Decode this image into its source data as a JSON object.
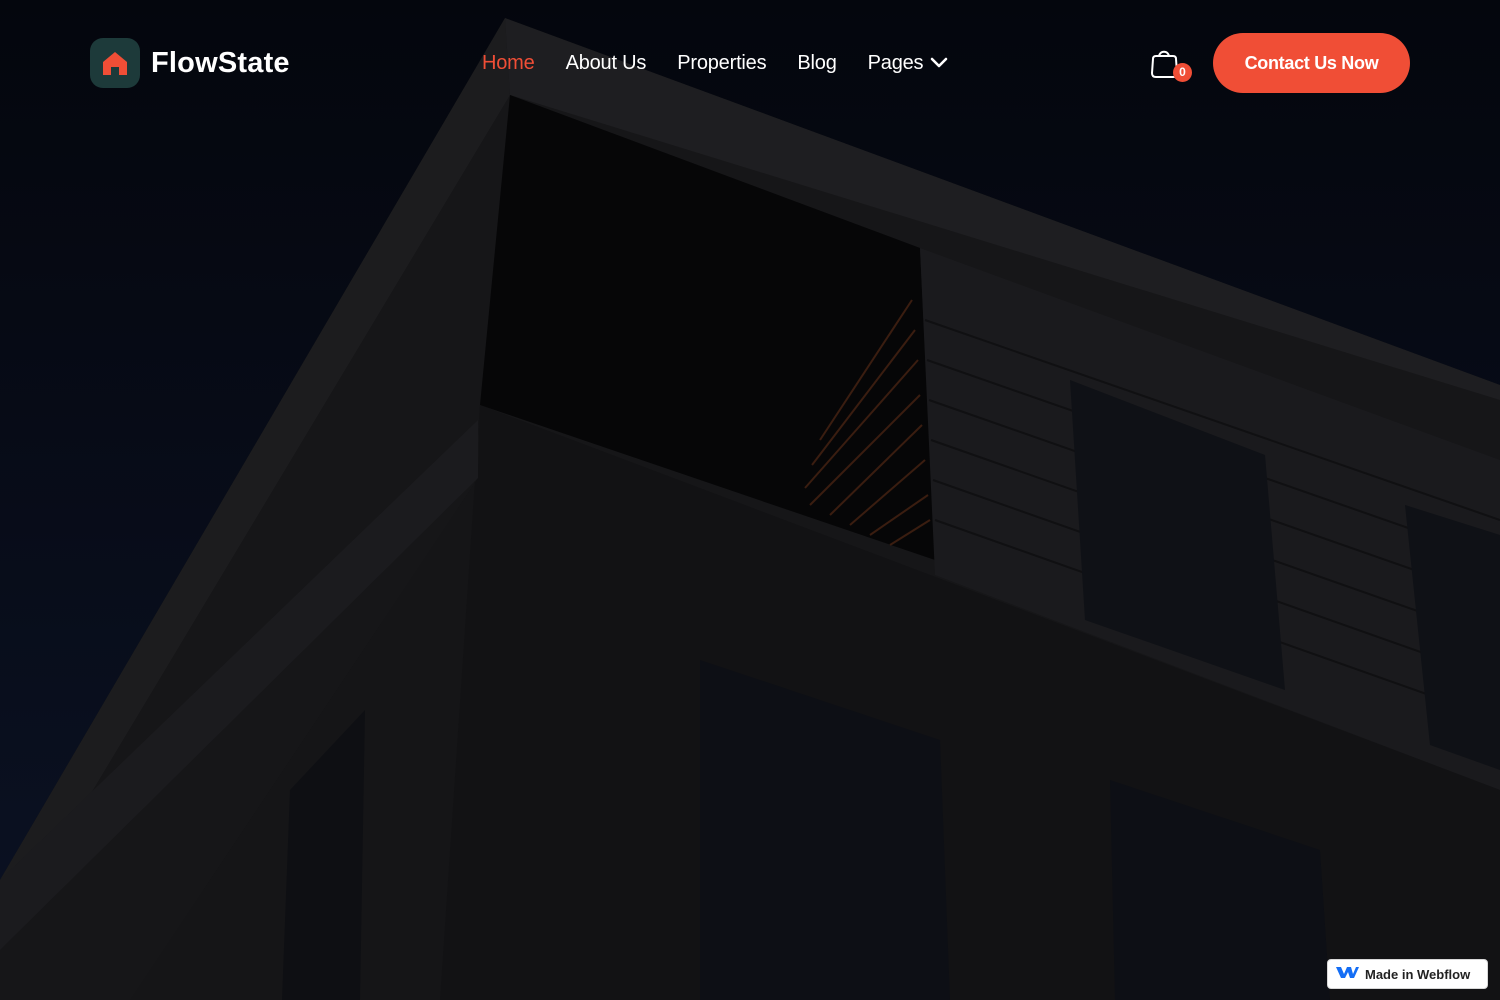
{
  "brand": {
    "name": "FlowState",
    "logo_icon": "house-icon",
    "accent_color": "#f04e36",
    "logo_badge_color": "#1d3a3a"
  },
  "nav": {
    "items": [
      {
        "label": "Home",
        "active": true
      },
      {
        "label": "About Us",
        "active": false
      },
      {
        "label": "Properties",
        "active": false
      },
      {
        "label": "Blog",
        "active": false
      }
    ],
    "dropdown": {
      "label": "Pages",
      "icon": "chevron-down-icon"
    }
  },
  "cart": {
    "icon": "shopping-bag-icon",
    "count": "0"
  },
  "cta": {
    "label": "Contact Us Now"
  },
  "hero": {
    "background": "dark building photo overlay"
  },
  "badge": {
    "label": "Made in Webflow",
    "icon": "webflow-icon"
  }
}
